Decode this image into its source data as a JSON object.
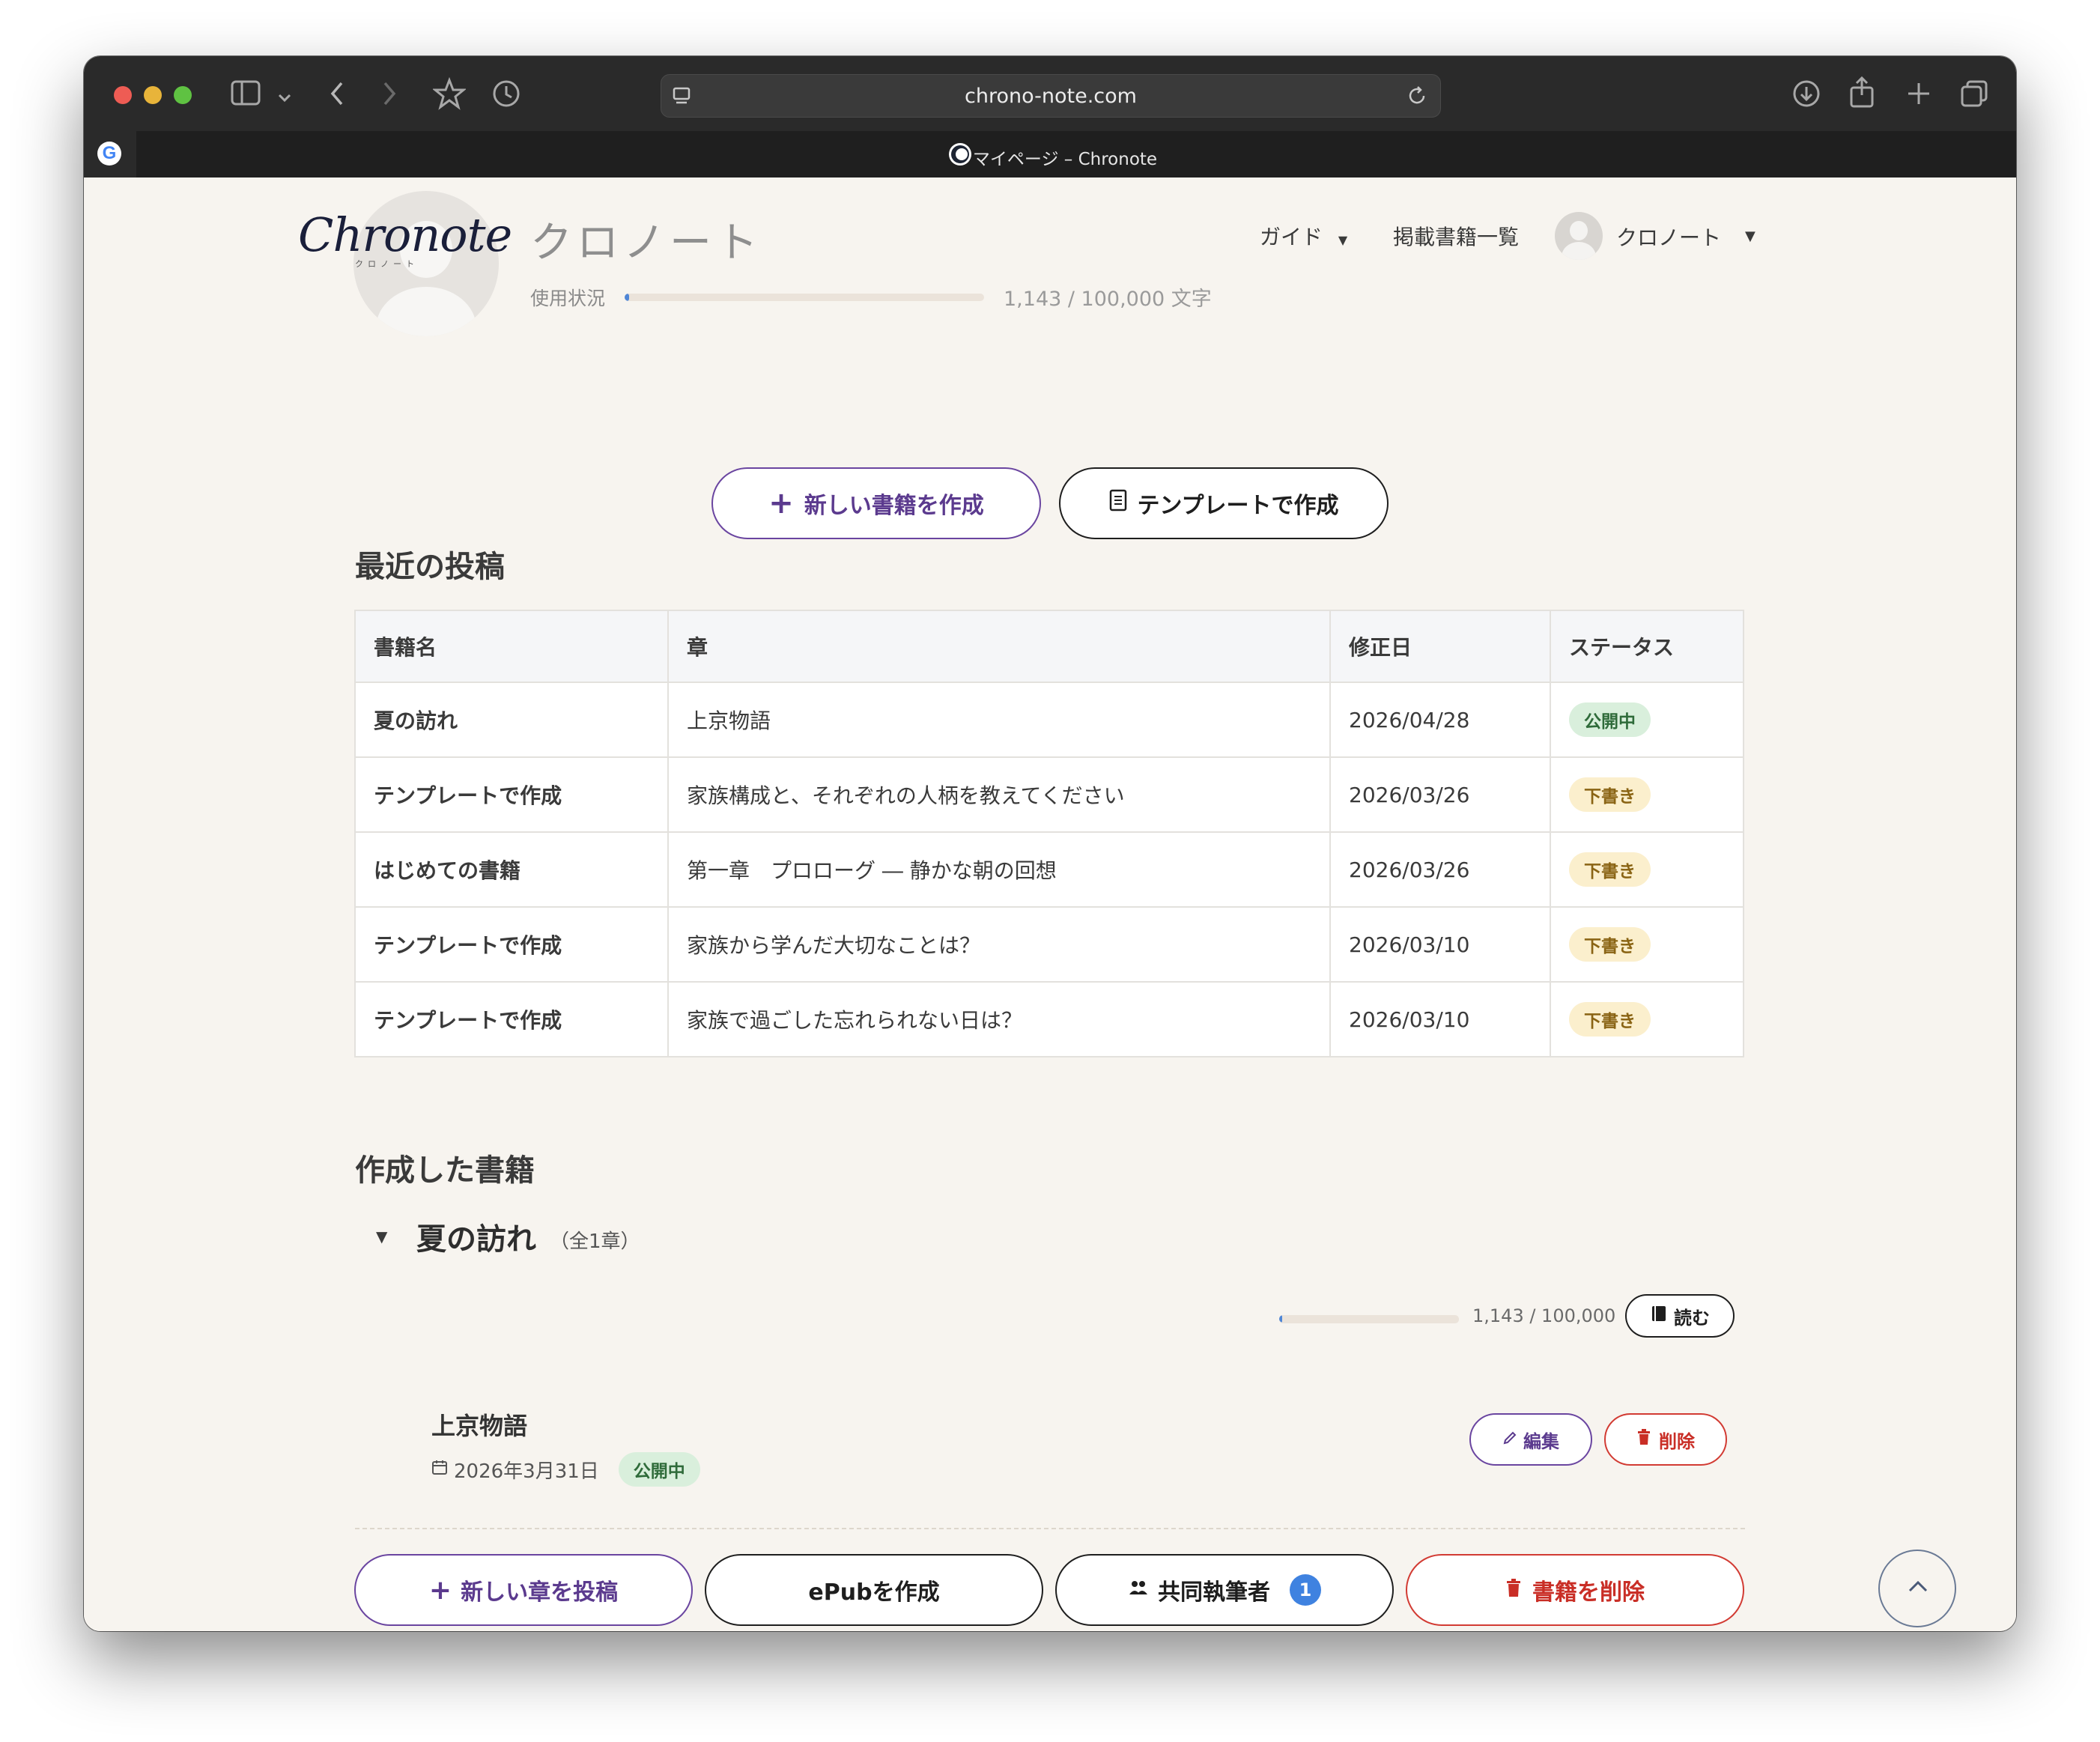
{
  "browser": {
    "url": "chrono-note.com",
    "tab_title": "マイページ – Chronote"
  },
  "header": {
    "logo_text": "Chronote",
    "logo_subtext": "クロノート",
    "username": "クロノート",
    "usage_label": "使用状況",
    "usage_text": "1,143 / 100,000 文字",
    "usage_fraction": 0.0114,
    "nav": {
      "guide": "ガイド",
      "books_list": "掲載書籍一覧",
      "user_menu": "クロノート"
    }
  },
  "actions": {
    "new_book": "新しい書籍を作成",
    "template_create": "テンプレートで作成"
  },
  "recent": {
    "heading": "最近の投稿",
    "columns": [
      "書籍名",
      "章",
      "修正日",
      "ステータス"
    ],
    "rows": [
      {
        "book": "夏の訪れ",
        "chapter": "上京物語",
        "date": "2026/04/28",
        "status": "公開中",
        "status_type": "published"
      },
      {
        "book": "テンプレートで作成",
        "chapter": "家族構成と、それぞれの人柄を教えてください",
        "date": "2026/03/26",
        "status": "下書き",
        "status_type": "draft"
      },
      {
        "book": "はじめての書籍",
        "chapter": "第一章　プロローグ ― 静かな朝の回想",
        "date": "2026/03/26",
        "status": "下書き",
        "status_type": "draft"
      },
      {
        "book": "テンプレートで作成",
        "chapter": "家族から学んだ大切なことは？",
        "date": "2026/03/10",
        "status": "下書き",
        "status_type": "draft"
      },
      {
        "book": "テンプレートで作成",
        "chapter": "家族で過ごした忘れられない日は？",
        "date": "2026/03/10",
        "status": "下書き",
        "status_type": "draft"
      }
    ]
  },
  "created": {
    "heading": "作成した書籍",
    "book": {
      "title": "夏の訪れ",
      "count": "（全1章）",
      "progress_text": "1,143 / 100,000",
      "progress_fraction": 0.0114,
      "read": "読む",
      "chapter": {
        "title": "上京物語",
        "date": "2026年3月31日",
        "status": "公開中",
        "edit": "編集",
        "delete": "削除"
      }
    },
    "footer": {
      "new_chapter": "新しい章を投稿",
      "epub": "ePubを作成",
      "coauthors": "共同執筆者",
      "coauthor_count": "1",
      "delete_book": "書籍を削除"
    }
  },
  "colors": {
    "accent_purple": "#6a45a0",
    "danger_red": "#d23b33",
    "page_bg": "#f7f4ef",
    "progress_blue": "#4f86d6"
  }
}
